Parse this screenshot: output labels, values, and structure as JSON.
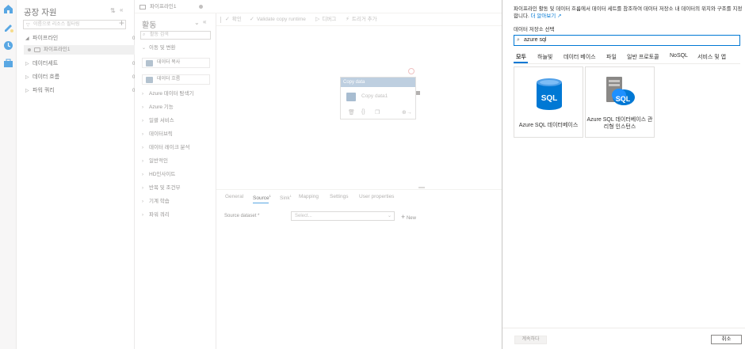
{
  "resources": {
    "title": "공장 자원",
    "collapse_label": "«",
    "filter_placeholder": "이름으로 리소스 필터링",
    "add_label": "+",
    "rows": [
      {
        "label": "파이프라인",
        "count": "0",
        "caret": "◢"
      },
      {
        "label": "데이터세트",
        "count": "0",
        "caret": "▷"
      },
      {
        "label": "데이터 흐름",
        "count": "0",
        "caret": "▷"
      },
      {
        "label": "파워 쿼리",
        "count": "0",
        "caret": "▷"
      }
    ],
    "pipeline_item": "파이프라인1"
  },
  "tab": {
    "label": "파이프라인1"
  },
  "activities": {
    "title": "활동",
    "collapse_label": "«",
    "search_placeholder": "활동 검색",
    "open_group": "이동 및 변환",
    "items": [
      "데이터 복사",
      "데이터 흐름"
    ],
    "groups": [
      "Azure 데이터 탐색기",
      "Azure 기능",
      "일괄 서비스",
      "데이터브릭",
      "데이터 레이크 분석",
      "일반적인",
      "HD인사이트",
      "반복 및 조건부",
      "기계 학습",
      "파워 쿼리"
    ]
  },
  "toolbar": {
    "validate": "확인",
    "validate_copy": "Validate copy runtime",
    "debug": "디버그",
    "trigger": "트리거 추가"
  },
  "node": {
    "header": "Copy data",
    "name": "Copy data1"
  },
  "properties": {
    "tabs": [
      "General",
      "Source",
      "Sink",
      "Mapping",
      "Settings",
      "User properties"
    ],
    "source_label": "Source dataset *",
    "select_placeholder": "Select...",
    "new_label": "New"
  },
  "blade": {
    "description": "파이프라인 활동 및 데이터 흐름에서 데이터 세트를 참조하여 데이터 저장소 내 데이터의 위치와 구조를 지정합니다.",
    "learn_more": "더 알아보기",
    "subtitle": "데이터 저장소 선택",
    "search_value": "azure sql",
    "tabs": [
      "모두",
      "하늘빛",
      "데이터 베이스",
      "파일",
      "일반 프로토콜",
      "NoSQL",
      "서비스 및 앱"
    ],
    "cards": [
      "Azure SQL 데이터베이스",
      "Azure SQL 데이터베이스 관리형 인스턴스"
    ],
    "sql_text": "SQL",
    "continue_label": "계속하다",
    "cancel_label": "취소"
  },
  "colors": {
    "accent": "#0078d4",
    "sql_blue": "#0078d4",
    "node_header": "#9bb5cf"
  },
  "icons": [
    "home-icon",
    "pencil-icon",
    "monitor-icon",
    "toolbox-icon",
    "search-icon",
    "pipeline-icon",
    "copy-icon",
    "dataflow-icon",
    "trash-icon",
    "code-icon",
    "clone-icon",
    "arrow-icon",
    "sql-database-icon",
    "sql-managed-instance-icon"
  ]
}
